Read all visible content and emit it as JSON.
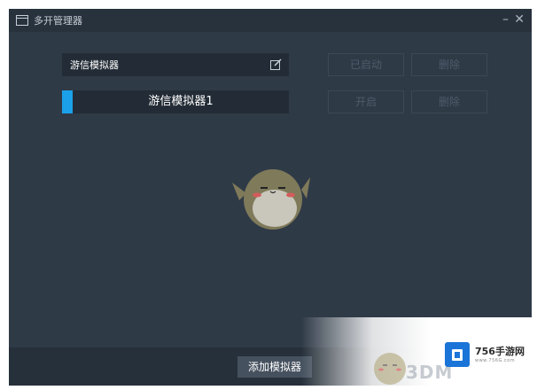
{
  "window": {
    "title": "多开管理器"
  },
  "template": {
    "name": "游信模拟器",
    "status_button": "已启动",
    "delete_button": "删除"
  },
  "instance": {
    "name": "游信模拟器1",
    "open_button": "开启",
    "delete_button": "删除"
  },
  "footer": {
    "add_button": "添加模拟器"
  },
  "watermark": {
    "site_name": "756手游网",
    "site_url": "www.756G.com",
    "brand": "3DM"
  },
  "colors": {
    "accent": "#1aa1ea",
    "window_bg": "#2f3a47",
    "titlebar_bg": "#28323d"
  }
}
